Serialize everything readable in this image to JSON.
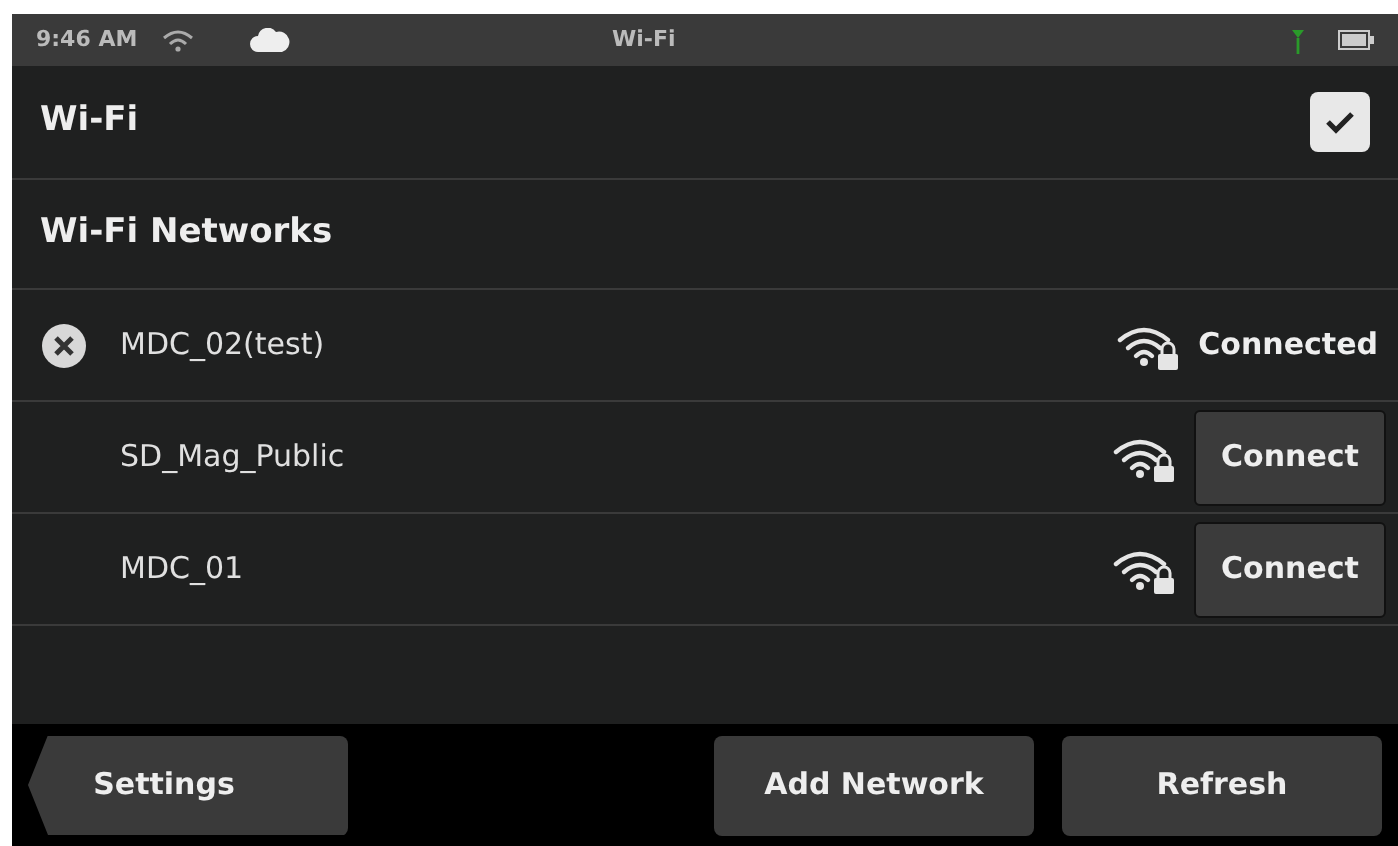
{
  "status_bar": {
    "time": "9:46 AM",
    "title": "Wi-Fi"
  },
  "wifi_toggle": {
    "label": "Wi-Fi",
    "checked": true
  },
  "networks_header": "Wi-Fi Networks",
  "networks": [
    {
      "name": "MDC_02(test)",
      "kind": "connected",
      "status": "Connected"
    },
    {
      "name": "SD_Mag_Public",
      "kind": "available",
      "action": "Connect"
    },
    {
      "name": "MDC_01",
      "kind": "available",
      "action": "Connect"
    }
  ],
  "bottom_bar": {
    "back": "Settings",
    "buttons": [
      "Add Network",
      "Refresh"
    ]
  }
}
